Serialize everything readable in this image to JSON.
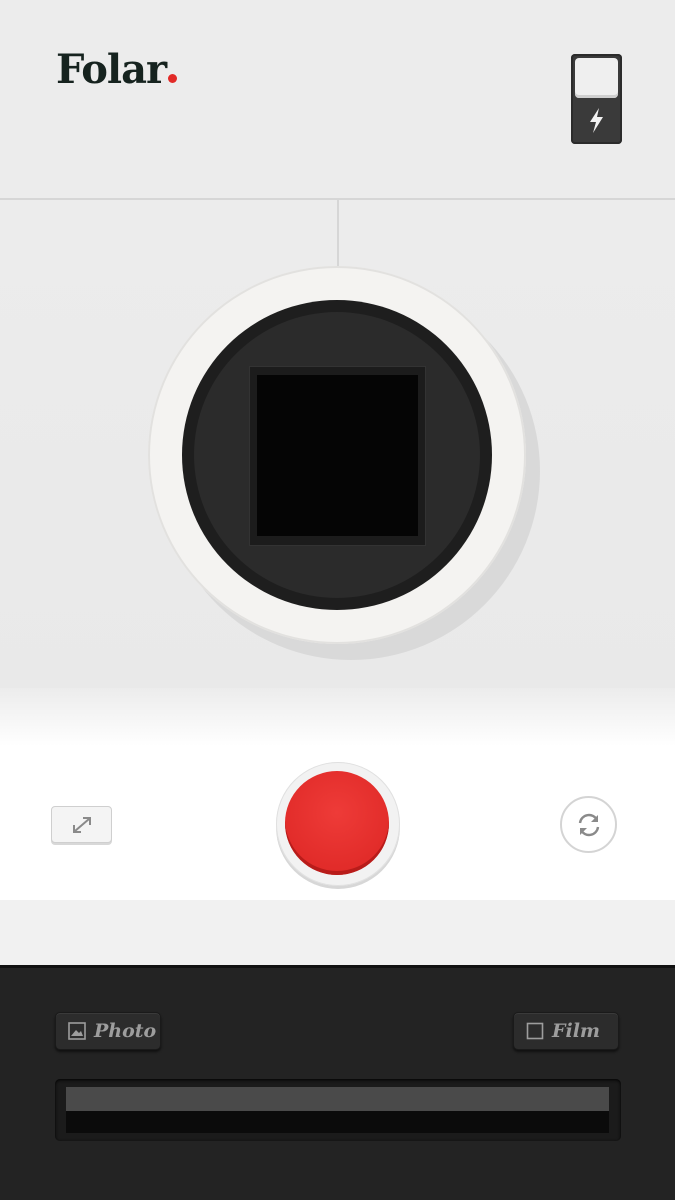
{
  "header": {
    "logo_text": "Folar",
    "logo_dot_color": "#e22a27",
    "flash_icon": "lightning-bolt-icon"
  },
  "camera": {
    "viewfinder_label": "",
    "shutter_color": "#e22a27"
  },
  "controls": {
    "expand_icon": "expand-arrows-icon",
    "rotate_icon": "rotate-camera-icon"
  },
  "tray": {
    "photo_label": "Photo",
    "photo_icon": "image-icon",
    "film_label": "Film",
    "film_icon": "square-icon"
  }
}
